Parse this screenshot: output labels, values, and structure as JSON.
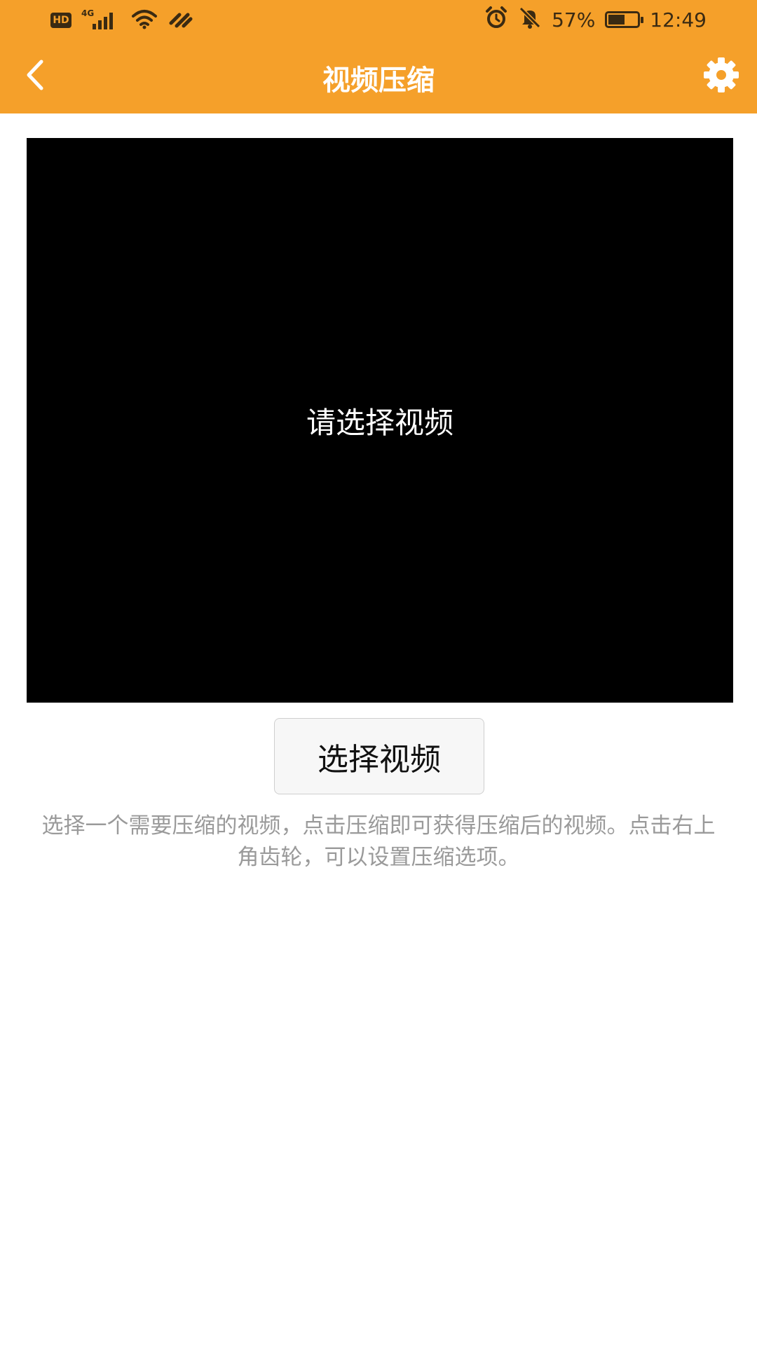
{
  "status_bar": {
    "hd_label": "HD",
    "network_label": "4G",
    "battery_percent": "57%",
    "battery_level": 0.57,
    "time": "12:49"
  },
  "toolbar": {
    "title": "视频压缩",
    "back_icon": "chevron-left-icon",
    "settings_icon": "gear-icon",
    "background_color": "#F5A02A"
  },
  "video": {
    "placeholder": "请选择视频"
  },
  "actions": {
    "select_label": "选择视频"
  },
  "description": "选择一个需要压缩的视频，点击压缩即可获得压缩后的视频。点击右上角齿轮，可以设置压缩选项。"
}
